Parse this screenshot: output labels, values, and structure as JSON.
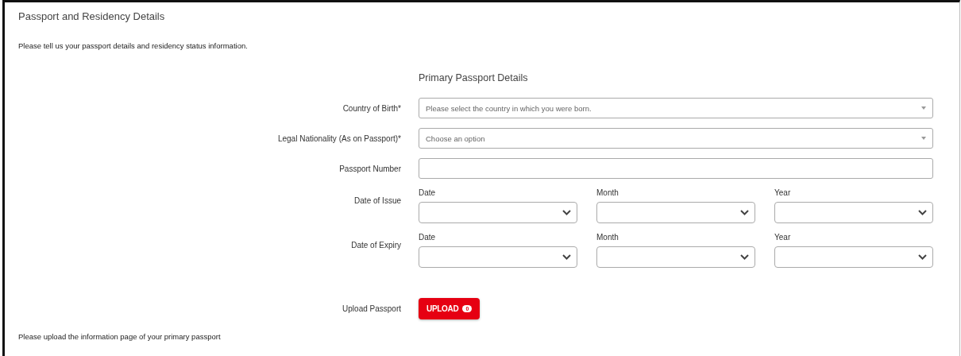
{
  "section": {
    "title": "Passport and Residency Details",
    "intro": "Please tell us your passport details and residency status information.",
    "heading": "Primary Passport Details",
    "fields": [
      {
        "kind": "select",
        "label": "Country of Birth*",
        "placeholder": "Please select the country in which you were born."
      },
      {
        "kind": "select",
        "label": "Legal Nationality (As on Passport)*",
        "placeholder": "Choose an option"
      },
      {
        "kind": "text",
        "label": "Passport Number"
      },
      {
        "kind": "date",
        "label": "Date of Issue",
        "parts": [
          "Date",
          "Month",
          "Year"
        ]
      },
      {
        "kind": "date",
        "label": "Date of Expiry",
        "parts": [
          "Date",
          "Month",
          "Year"
        ]
      }
    ],
    "upload": {
      "label": "Upload Passport",
      "button": "UPLOAD",
      "count": "0"
    },
    "footer": "Please upload the information page of your primary passport"
  }
}
